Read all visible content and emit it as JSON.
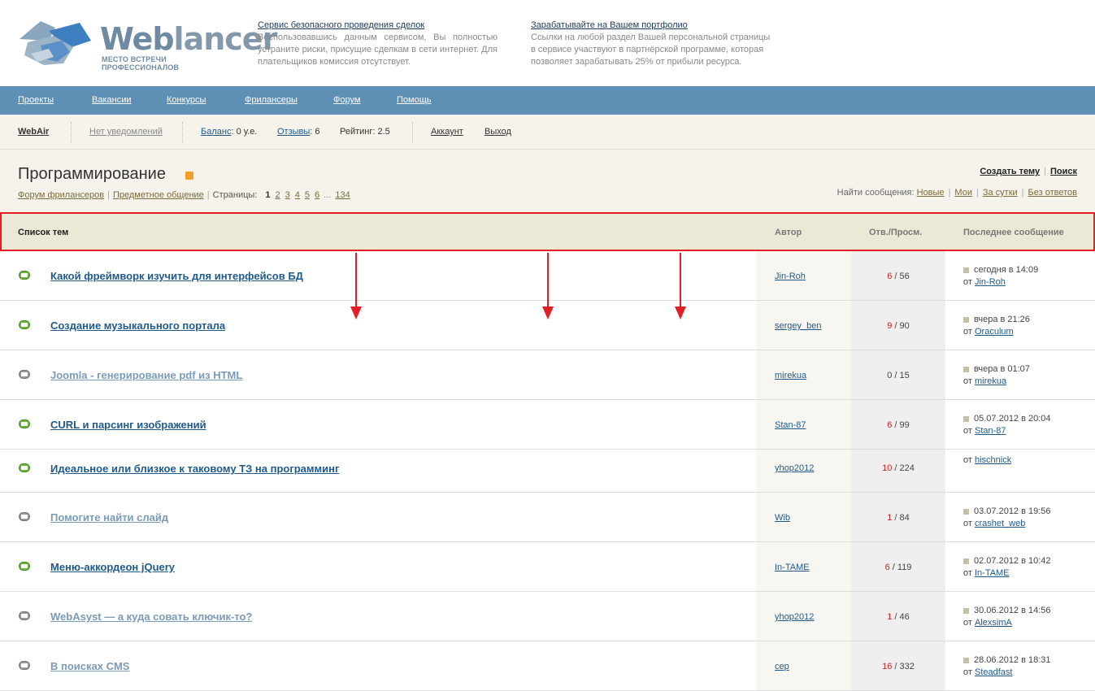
{
  "logo": {
    "word1": "Web",
    "word2": "lancer",
    "tagline": "МЕСТО ВСТРЕЧИ ПРОФЕССИОНАЛОВ"
  },
  "promo1": {
    "title": "Сервис безопасного проведения сделок",
    "text": "Воспользовавшись данным сервисом, Вы полностью устраните риски, присущие сделкам в сети интернет. Для плательщиков комиссия отсутствует."
  },
  "promo2": {
    "title": "Зарабатывайте на Вашем портфолио",
    "text": "Ссылки на любой раздел Вашей персональной страницы в сервисе участвуют в партнёрской программе, которая позволяет зарабатывать 25% от прибыли ресурса."
  },
  "nav": [
    "Проекты",
    "Вакансии",
    "Конкурсы",
    "Фрилансеры",
    "Форум",
    "Помощь"
  ],
  "userbar": {
    "username": "WebAir",
    "notifications": "Нет уведомлений",
    "balance_label": "Баланс",
    "balance_value": ": 0 у.е.",
    "reviews_label": "Отзывы",
    "reviews_value": ": 6",
    "rating": "Рейтинг: 2.5",
    "account": "Аккаунт",
    "logout": "Выход"
  },
  "page": {
    "title": "Программирование",
    "crumb1": "Форум фрилансеров",
    "crumb2": "Предметное общение",
    "pages_label": "Страницы:",
    "pages": [
      "1",
      "2",
      "3",
      "4",
      "5",
      "6"
    ],
    "pages_dots": "...",
    "last_page": "134",
    "create_topic": "Создать тему",
    "search": "Поиск",
    "find_label": "Найти сообщения:",
    "find_new": "Новые",
    "find_mine": "Мои",
    "find_day": "За сутки",
    "find_noreply": "Без ответов"
  },
  "table": {
    "col_topics": "Список тем",
    "col_author": "Автор",
    "col_stats": "Отв./Просм.",
    "col_last": "Последнее сообщение",
    "last_from": "от",
    "stats_sep": " / ",
    "rows": [
      {
        "title": "Какой фреймворк изучить для интерфейсов БД",
        "unread": true,
        "author": "Jin-Roh",
        "replies": "6",
        "views": "56",
        "last_date": "сегодня в 14:09",
        "last_user": "Jin-Roh"
      },
      {
        "title": "Создание музыкального портала",
        "unread": true,
        "author": "sergey_ben",
        "replies": "9",
        "views": "90",
        "last_date": "вчера в 21:26",
        "last_user": "Oraculum"
      },
      {
        "title": "Joomla - генерирование pdf из HTML",
        "unread": false,
        "author": "mirekua",
        "replies": "0",
        "views": "15",
        "last_date": "вчера в 01:07",
        "last_user": "mirekua"
      },
      {
        "title": "CURL и парсинг изображений",
        "unread": true,
        "author": "Stan-87",
        "replies": "6",
        "views": "99",
        "last_date": "05.07.2012 в 20:04",
        "last_user": "Stan-87"
      },
      {
        "title": "Идеальное или близкое к таковому ТЗ на программинг",
        "unread": true,
        "author": "yhop2012",
        "replies": "10",
        "views": "224",
        "last_date": "",
        "last_user": "hischnick"
      },
      {
        "title": "Помогите найти слайд",
        "unread": false,
        "author": "Wib",
        "replies": "1",
        "views": "84",
        "last_date": "03.07.2012 в 19:56",
        "last_user": "crashet_web"
      },
      {
        "title": "Меню-аккордеон jQuery",
        "unread": true,
        "author": "In-TAME",
        "replies": "6",
        "views": "119",
        "last_date": "02.07.2012 в 10:42",
        "last_user": "In-TAME"
      },
      {
        "title": "WebAsyst — а куда совать ключик-то?",
        "unread": false,
        "author": "yhop2012",
        "replies": "1",
        "views": "46",
        "last_date": "30.06.2012 в 14:56",
        "last_user": "AlexsimA"
      },
      {
        "title": "В поисках CMS",
        "unread": false,
        "author": "cep",
        "replies": "16",
        "views": "332",
        "last_date": "28.06.2012 в 18:31",
        "last_user": "Steadfast"
      }
    ]
  }
}
